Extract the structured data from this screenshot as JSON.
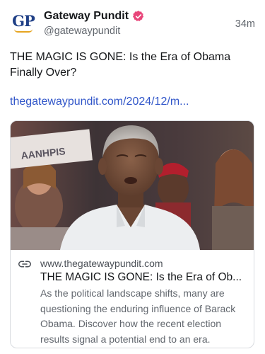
{
  "author": {
    "avatar_letters": "GP",
    "display_name": "Gateway Pundit",
    "handle": "@gatewaypundit",
    "verified": true,
    "timestamp": "34m"
  },
  "post": {
    "text": "THE MAGIC IS GONE: Is the Era of Obama Finally Over?",
    "link_text": "thegatewaypundit.com/2024/12/m..."
  },
  "link_card": {
    "image_sign_text": "AANHPIS",
    "domain": "www.thegatewaypundit.com",
    "title": "THE MAGIC IS GONE: Is the Era of Ob...",
    "description": "As the political landscape shifts, many are questioning the enduring influence of Barack Obama. Discover how the recent election results signal a potential end to an era."
  },
  "colors": {
    "link": "#3156c9",
    "verified_badge": "#e8467a",
    "brand_blue": "#1f3f86",
    "brand_gold": "#e6a521",
    "muted_text": "#62676e"
  },
  "icons": {
    "verified": "verified-badge-icon",
    "link": "link-icon"
  }
}
